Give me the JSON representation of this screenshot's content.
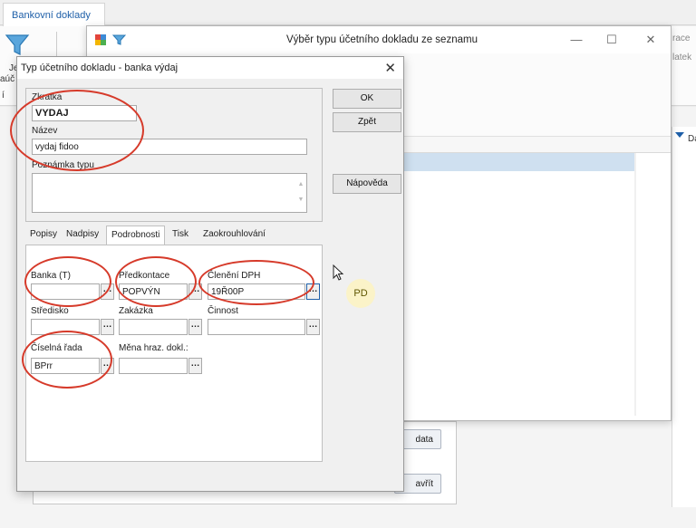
{
  "app": {
    "tab_label": "Bankovní doklady",
    "ribbon_fragments": [
      "Je",
      "aúč",
      "í"
    ],
    "right_fragments": [
      "race",
      "latek",
      "Da"
    ]
  },
  "list_window": {
    "title": "Výběr typu účetního dokladu ze seznamu",
    "minimize": "—",
    "maximize": "☐",
    "close": "✕"
  },
  "background_panel": {
    "btn1_frag": "data",
    "btn2_frag": "avřít"
  },
  "dialog": {
    "title": "Typ účetního dokladu - banka výdaj",
    "close": "✕",
    "zkratka": {
      "label": "Zkratka",
      "value": "VYDAJ"
    },
    "nazev": {
      "label": "Název",
      "value": "vydaj fidoo"
    },
    "poznamka": {
      "label": "Poznámka typu",
      "value": ""
    },
    "buttons": {
      "ok": "OK",
      "back": "Zpět",
      "help": "Nápověda"
    },
    "tabs": [
      "Popisy",
      "Nadpisy",
      "Podrobnosti",
      "Tisk",
      "Zaokrouhlování"
    ],
    "active_tab": "Podrobnosti",
    "fields": {
      "banka": {
        "label": "Banka (T)",
        "value": ""
      },
      "predkontace": {
        "label": "Předkontace",
        "value": "POPVÝN"
      },
      "cleneni_dph": {
        "label": "Členění DPH",
        "value": "19Ř00P"
      },
      "stredisko": {
        "label": "Středisko",
        "value": ""
      },
      "zakazka": {
        "label": "Zakázka",
        "value": ""
      },
      "cinnost": {
        "label": "Činnost",
        "value": ""
      },
      "ciselna_rada": {
        "label": "Číselná řada",
        "value": "BPrr"
      },
      "mena": {
        "label": "Měna hraz. dokl.:",
        "value": ""
      }
    },
    "ellipsis": "…"
  },
  "overlay": {
    "avatar_initials": "PD"
  },
  "colors": {
    "accent": "#1e5fa8",
    "annotation": "#d63a2a",
    "selection": "#cfe0f0",
    "avatar_bg": "#fbf3c8"
  }
}
